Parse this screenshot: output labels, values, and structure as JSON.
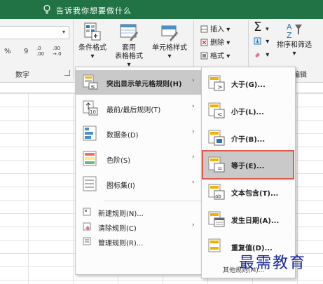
{
  "tell_me": {
    "text": "告诉我你想要做什么",
    "icon": "lightbulb-icon"
  },
  "ribbon": {
    "number_group": {
      "label": "数字",
      "symbols": {
        "percent": "%",
        "comma": "9",
        "increase_decimal": ".0 .00",
        "decrease_decimal": ".00 →.0"
      }
    },
    "styles": {
      "conditional_formatting": "条件格式",
      "format_as_table_line1": "套用",
      "format_as_table_line2": "表格格式",
      "cell_styles": "单元格样式"
    },
    "cells": {
      "insert": "插入",
      "delete": "删除",
      "format": "格式"
    },
    "editing": {
      "sum_symbol": "Σ",
      "sort_filter": "排序和筛选",
      "label": "编辑"
    }
  },
  "conditional_menu": {
    "items": [
      {
        "label": "突出显示单元格规则(H)",
        "has_submenu": true,
        "highlighted": true
      },
      {
        "label": "最前/最后规则(T)",
        "has_submenu": true
      },
      {
        "label": "数据条(D)",
        "has_submenu": true
      },
      {
        "label": "色阶(S)",
        "has_submenu": true
      },
      {
        "label": "图标集(I)",
        "has_submenu": true
      }
    ],
    "small_items": [
      {
        "label": "新建规则(N)..."
      },
      {
        "label": "清除规则(C)",
        "has_submenu": true
      },
      {
        "label": "管理规则(R)..."
      }
    ],
    "arrow": "›"
  },
  "highlight_submenu": {
    "items": [
      {
        "label": "大于(G)..."
      },
      {
        "label": "小于(L)..."
      },
      {
        "label": "介于(B)..."
      },
      {
        "label": "等于(E)...",
        "selected": true
      },
      {
        "label": "文本包含(T)..."
      },
      {
        "label": "发生日期(A)..."
      },
      {
        "label": "重复值(D)..."
      }
    ],
    "more": "其他规则(M)..."
  },
  "watermark": "最需教育",
  "colors": {
    "excel_green": "#217346",
    "highlight_border": "#e05a4a",
    "menu_hover": "#c9c9c9",
    "watermark": "#1a2a9c"
  }
}
